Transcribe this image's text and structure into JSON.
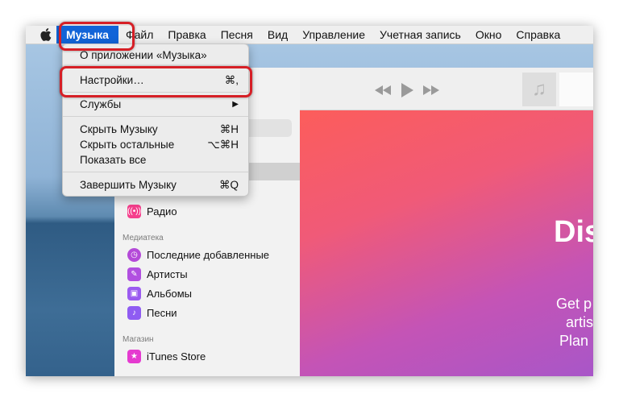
{
  "menubar": {
    "app_menu": "Музыка",
    "items": [
      "Файл",
      "Правка",
      "Песня",
      "Вид",
      "Управление",
      "Учетная запись",
      "Окно",
      "Справка"
    ]
  },
  "dropdown": {
    "about": "О приложении «Музыка»",
    "preferences": "Настройки…",
    "preferences_shortcut": "⌘,",
    "services": "Службы",
    "hide": "Скрыть Музыку",
    "hide_shortcut": "⌘H",
    "hide_others": "Скрыть остальные",
    "hide_others_shortcut": "⌥⌘H",
    "show_all": "Показать все",
    "quit": "Завершить Музыку",
    "quit_shortcut": "⌘Q"
  },
  "sidebar": {
    "radio": "Радио",
    "library_header": "Медиатека",
    "library_items": [
      "Последние добавленные",
      "Артисты",
      "Альбомы",
      "Песни"
    ],
    "store_header": "Магазин",
    "store_item": "iTunes Store"
  },
  "content": {
    "title": "Dis",
    "lines": [
      "Get p",
      "artis",
      "Plan"
    ]
  },
  "colors": {
    "menu_highlight": "#1164d8",
    "annotation_red": "#d61f26"
  }
}
